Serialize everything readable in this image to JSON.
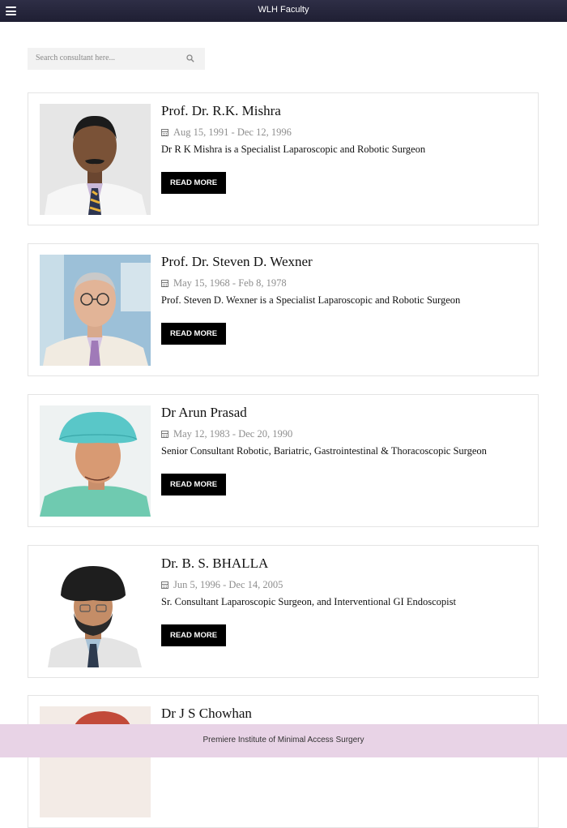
{
  "header": {
    "title": "WLH Faculty",
    "menu_icon": "hamburger-icon"
  },
  "search": {
    "placeholder": "Search consultant here...",
    "icon": "search-icon"
  },
  "faculty": [
    {
      "name": "Prof. Dr. R.K. Mishra",
      "dates": "Aug 15, 1991 - Dec 12, 1996",
      "description": "Dr R K Mishra is a Specialist Laparoscopic and Robotic Surgeon",
      "button": "READ MORE"
    },
    {
      "name": "Prof. Dr. Steven D. Wexner",
      "dates": "May 15, 1968 - Feb 8, 1978",
      "description": "Prof. Steven D. Wexner is a Specialist Laparoscopic and Robotic Surgeon",
      "button": "READ MORE"
    },
    {
      "name": "Dr Arun Prasad",
      "dates": "May 12, 1983 - Dec 20, 1990",
      "description": "Senior Consultant Robotic, Bariatric, Gastrointestinal & Thoracoscopic Surgeon",
      "button": "READ MORE"
    },
    {
      "name": "Dr. B. S. BHALLA",
      "dates": "Jun 5, 1996 - Dec 14, 2005",
      "description": "Sr. Consultant Laparoscopic Surgeon, and Interventional GI Endoscopist",
      "button": "READ MORE"
    },
    {
      "name": "Dr J S Chowhan"
    }
  ],
  "footer": {
    "text": "Premiere Institute of Minimal Access Surgery"
  },
  "colors": {
    "header_bg": "#26263c",
    "button_bg": "#000000",
    "footer_bg": "#e8d3e6"
  }
}
